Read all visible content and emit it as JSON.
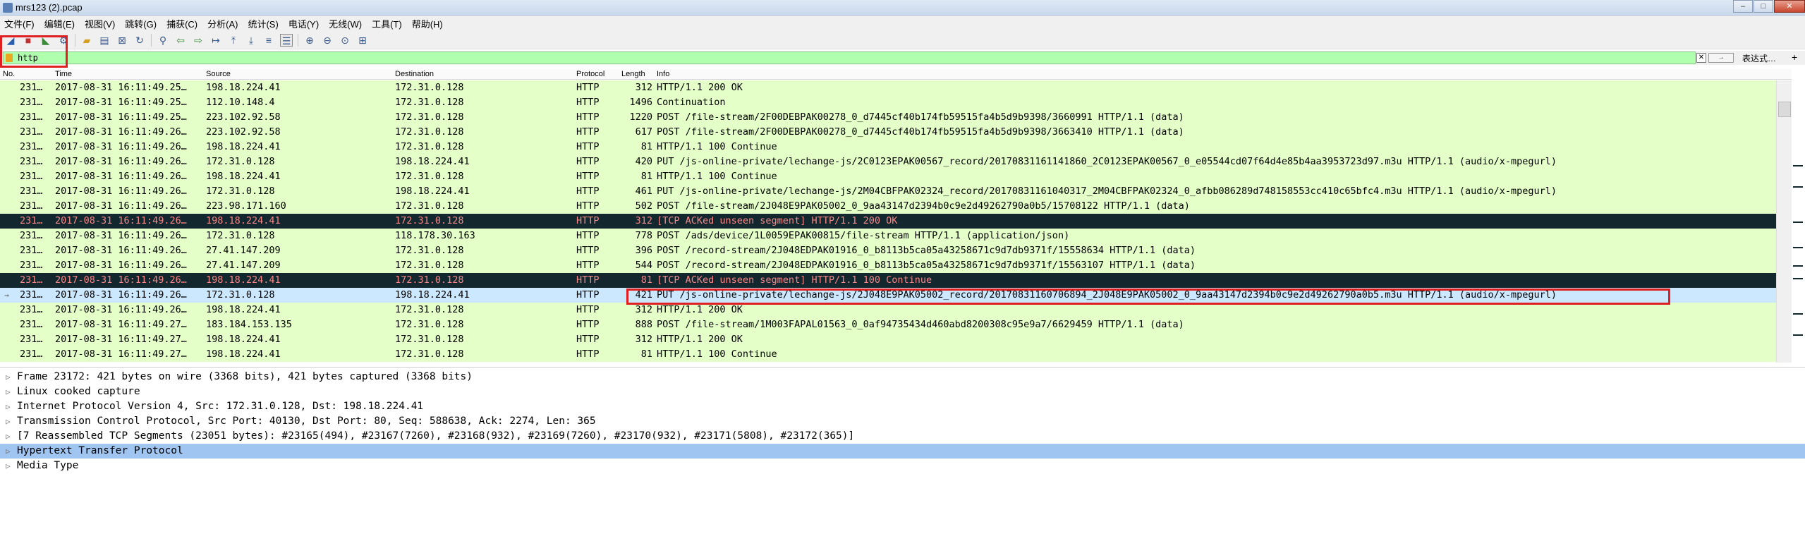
{
  "window": {
    "title": "mrs123 (2).pcap",
    "minimize": "–",
    "maximize": "□",
    "close": "✕"
  },
  "menu": [
    "文件(F)",
    "编辑(E)",
    "视图(V)",
    "跳转(G)",
    "捕获(C)",
    "分析(A)",
    "统计(S)",
    "电话(Y)",
    "无线(W)",
    "工具(T)",
    "帮助(H)"
  ],
  "filter": {
    "value": "http",
    "clear": "✕",
    "apply": "→",
    "expression_label": "表达式…",
    "add": "+"
  },
  "columns": {
    "no": "No.",
    "time": "Time",
    "source": "Source",
    "destination": "Destination",
    "protocol": "Protocol",
    "length": "Length",
    "info": "Info"
  },
  "packets": [
    {
      "no": "231…",
      "time": "2017-08-31 16:11:49.25…",
      "src": "198.18.224.41",
      "dst": "172.31.0.128",
      "proto": "HTTP",
      "len": "312",
      "info": "HTTP/1.1 200 OK",
      "style": "normal"
    },
    {
      "no": "231…",
      "time": "2017-08-31 16:11:49.25…",
      "src": "112.10.148.4",
      "dst": "172.31.0.128",
      "proto": "HTTP",
      "len": "1496",
      "info": "Continuation",
      "style": "normal"
    },
    {
      "no": "231…",
      "time": "2017-08-31 16:11:49.25…",
      "src": "223.102.92.58",
      "dst": "172.31.0.128",
      "proto": "HTTP",
      "len": "1220",
      "info": "POST /file-stream/2F00DEBPAK00278_0_d7445cf40b174fb59515fa4b5d9b9398/3660991 HTTP/1.1  (data)",
      "style": "normal"
    },
    {
      "no": "231…",
      "time": "2017-08-31 16:11:49.26…",
      "src": "223.102.92.58",
      "dst": "172.31.0.128",
      "proto": "HTTP",
      "len": "617",
      "info": "POST /file-stream/2F00DEBPAK00278_0_d7445cf40b174fb59515fa4b5d9b9398/3663410 HTTP/1.1  (data)",
      "style": "normal"
    },
    {
      "no": "231…",
      "time": "2017-08-31 16:11:49.26…",
      "src": "198.18.224.41",
      "dst": "172.31.0.128",
      "proto": "HTTP",
      "len": "81",
      "info": "HTTP/1.1 100 Continue",
      "style": "normal"
    },
    {
      "no": "231…",
      "time": "2017-08-31 16:11:49.26…",
      "src": "172.31.0.128",
      "dst": "198.18.224.41",
      "proto": "HTTP",
      "len": "420",
      "info": "PUT /js-online-private/lechange-js/2C0123EPAK00567_record/20170831161141860_2C0123EPAK00567_0_e05544cd07f64d4e85b4aa3953723d97.m3u HTTP/1.1  (audio/x-mpegurl)",
      "style": "normal"
    },
    {
      "no": "231…",
      "time": "2017-08-31 16:11:49.26…",
      "src": "198.18.224.41",
      "dst": "172.31.0.128",
      "proto": "HTTP",
      "len": "81",
      "info": "HTTP/1.1 100 Continue",
      "style": "normal"
    },
    {
      "no": "231…",
      "time": "2017-08-31 16:11:49.26…",
      "src": "172.31.0.128",
      "dst": "198.18.224.41",
      "proto": "HTTP",
      "len": "461",
      "info": "PUT /js-online-private/lechange-js/2M04CBFPAK02324_record/20170831161040317_2M04CBFPAK02324_0_afbb086289d748158553cc410c65bfc4.m3u HTTP/1.1  (audio/x-mpegurl)",
      "style": "normal"
    },
    {
      "no": "231…",
      "time": "2017-08-31 16:11:49.26…",
      "src": "223.98.171.160",
      "dst": "172.31.0.128",
      "proto": "HTTP",
      "len": "502",
      "info": "POST /file-stream/2J048E9PAK05002_0_9aa43147d2394b0c9e2d49262790a0b5/15708122 HTTP/1.1  (data)",
      "style": "normal"
    },
    {
      "no": "231…",
      "time": "2017-08-31 16:11:49.26…",
      "src": "198.18.224.41",
      "dst": "172.31.0.128",
      "proto": "HTTP",
      "len": "312",
      "info": "[TCP ACKed unseen segment] HTTP/1.1 200 OK",
      "style": "dark"
    },
    {
      "no": "231…",
      "time": "2017-08-31 16:11:49.26…",
      "src": "172.31.0.128",
      "dst": "118.178.30.163",
      "proto": "HTTP",
      "len": "778",
      "info": "POST /ads/device/1L0059EPAK00815/file-stream HTTP/1.1  (application/json)",
      "style": "normal"
    },
    {
      "no": "231…",
      "time": "2017-08-31 16:11:49.26…",
      "src": "27.41.147.209",
      "dst": "172.31.0.128",
      "proto": "HTTP",
      "len": "396",
      "info": "POST /record-stream/2J048EDPAK01916_0_b8113b5ca05a43258671c9d7db9371f/15558634 HTTP/1.1  (data)",
      "style": "normal"
    },
    {
      "no": "231…",
      "time": "2017-08-31 16:11:49.26…",
      "src": "27.41.147.209",
      "dst": "172.31.0.128",
      "proto": "HTTP",
      "len": "544",
      "info": "POST /record-stream/2J048EDPAK01916_0_b8113b5ca05a43258671c9d7db9371f/15563107 HTTP/1.1  (data)",
      "style": "normal"
    },
    {
      "no": "231…",
      "time": "2017-08-31 16:11:49.26…",
      "src": "198.18.224.41",
      "dst": "172.31.0.128",
      "proto": "HTTP",
      "len": "81",
      "info": "[TCP ACKed unseen segment] HTTP/1.1 100 Continue",
      "style": "dark"
    },
    {
      "no": "231…",
      "time": "2017-08-31 16:11:49.26…",
      "src": "172.31.0.128",
      "dst": "198.18.224.41",
      "proto": "HTTP",
      "len": "421",
      "info": "PUT /js-online-private/lechange-js/2J048E9PAK05002_record/20170831160706894_2J048E9PAK05002_0_9aa43147d2394b0c9e2d49262790a0b5.m3u HTTP/1.1  (audio/x-mpegurl)",
      "style": "sel"
    },
    {
      "no": "231…",
      "time": "2017-08-31 16:11:49.26…",
      "src": "198.18.224.41",
      "dst": "172.31.0.128",
      "proto": "HTTP",
      "len": "312",
      "info": "HTTP/1.1 200 OK",
      "style": "normal"
    },
    {
      "no": "231…",
      "time": "2017-08-31 16:11:49.27…",
      "src": "183.184.153.135",
      "dst": "172.31.0.128",
      "proto": "HTTP",
      "len": "888",
      "info": "POST /file-stream/1M003FAPAL01563_0_0af94735434d460abd8200308c95e9a7/6629459 HTTP/1.1  (data)",
      "style": "normal"
    },
    {
      "no": "231…",
      "time": "2017-08-31 16:11:49.27…",
      "src": "198.18.224.41",
      "dst": "172.31.0.128",
      "proto": "HTTP",
      "len": "312",
      "info": "HTTP/1.1 200 OK",
      "style": "normal"
    },
    {
      "no": "231…",
      "time": "2017-08-31 16:11:49.27…",
      "src": "198.18.224.41",
      "dst": "172.31.0.128",
      "proto": "HTTP",
      "len": "81",
      "info": "HTTP/1.1 100 Continue",
      "style": "normal"
    }
  ],
  "details": [
    {
      "text": "Frame 23172: 421 bytes on wire (3368 bits), 421 bytes captured (3368 bits)",
      "hl": false
    },
    {
      "text": "Linux cooked capture",
      "hl": false
    },
    {
      "text": "Internet Protocol Version 4, Src: 172.31.0.128, Dst: 198.18.224.41",
      "hl": false
    },
    {
      "text": "Transmission Control Protocol, Src Port: 40130, Dst Port: 80, Seq: 588638, Ack: 2274, Len: 365",
      "hl": false
    },
    {
      "text": "[7 Reassembled TCP Segments (23051 bytes): #23165(494), #23167(7260), #23168(932), #23169(7260), #23170(932), #23171(5808), #23172(365)]",
      "hl": false
    },
    {
      "text": "Hypertext Transfer Protocol",
      "hl": true
    },
    {
      "text": "Media Type",
      "hl": false
    }
  ],
  "toolbar_icons": [
    "shark-fin-icon",
    "stop-icon",
    "restart-icon",
    "options-icon",
    "open-icon",
    "save-icon",
    "close-file-icon",
    "reload-icon",
    "find-icon",
    "back-icon",
    "forward-icon",
    "goto-icon",
    "first-icon",
    "last-icon",
    "autoscroll-icon",
    "colorize-icon",
    "zoom-in-icon",
    "zoom-out-icon",
    "zoom-reset-icon",
    "resize-columns-icon"
  ],
  "colors": {
    "row_normal": "#e4ffc7",
    "row_dark": "#12272e",
    "row_dark_text": "#f78787",
    "row_selected": "#cce8ff",
    "filter_bg": "#afffaf",
    "highlight": "#9fc5f0",
    "annotation": "#e02020"
  }
}
